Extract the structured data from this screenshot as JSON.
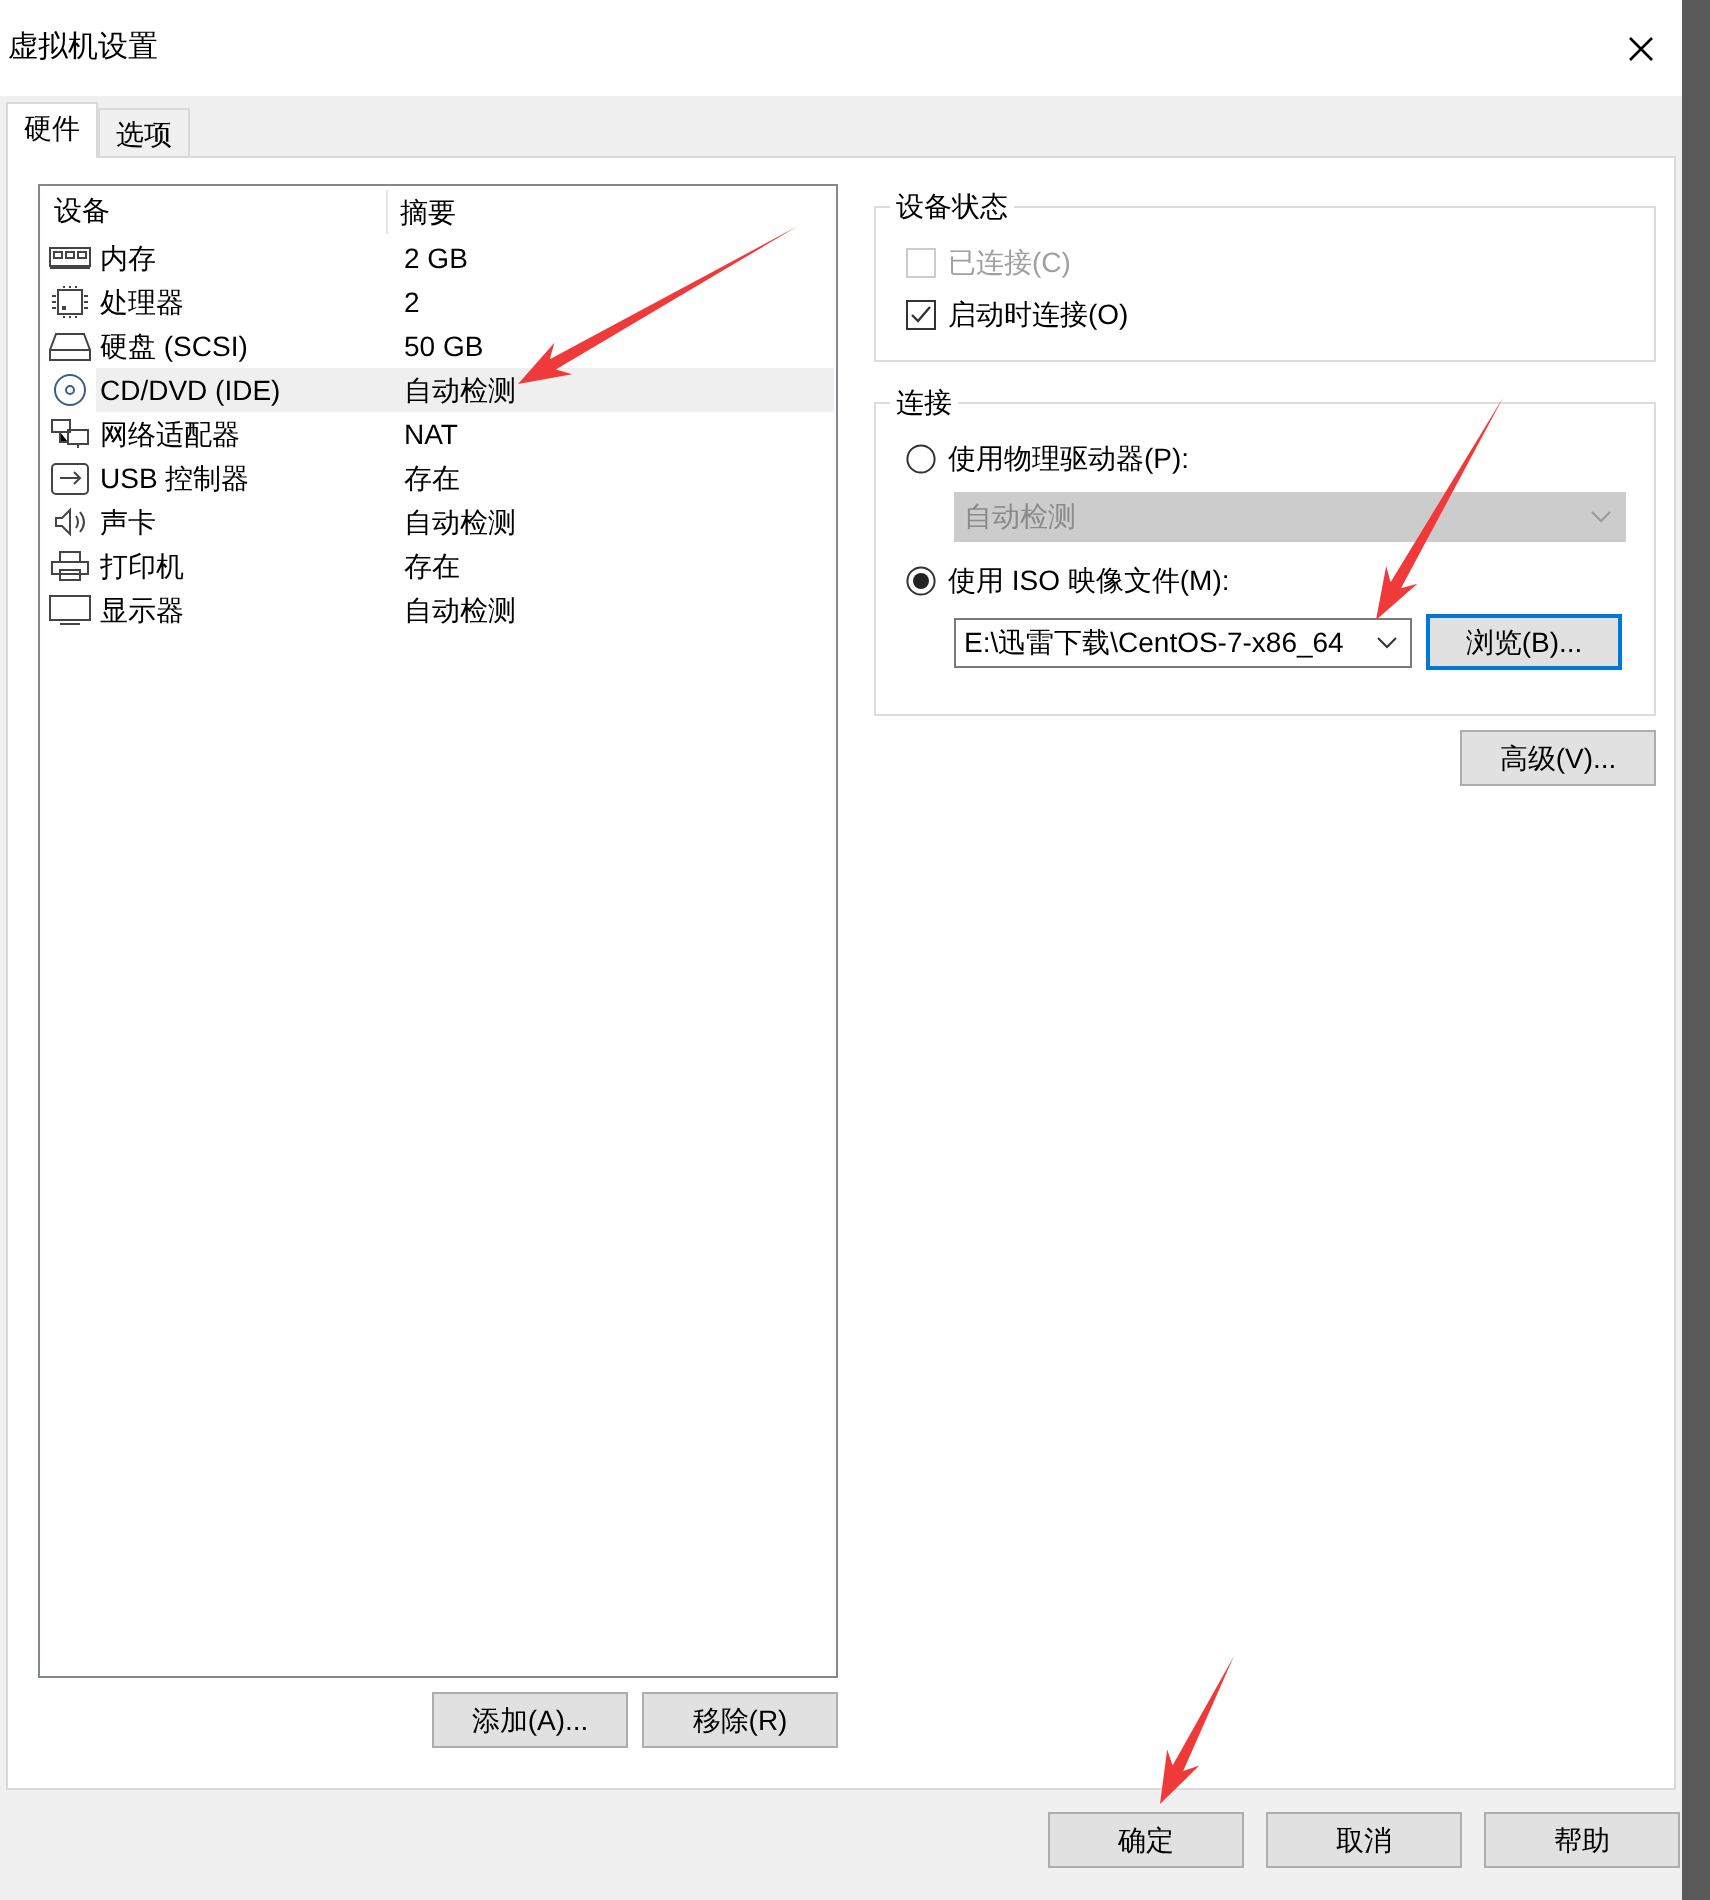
{
  "window": {
    "title": "虚拟机设置"
  },
  "tabs": [
    {
      "label": "硬件",
      "selected": true
    },
    {
      "label": "选项",
      "selected": false
    }
  ],
  "device_list": {
    "columns": [
      "设备",
      "摘要"
    ],
    "rows": [
      {
        "kind": "memory",
        "device": "内存",
        "summary": "2 GB",
        "selected": false
      },
      {
        "kind": "cpu",
        "device": "处理器",
        "summary": "2",
        "selected": false
      },
      {
        "kind": "disk",
        "device": "硬盘 (SCSI)",
        "summary": "50 GB",
        "selected": false
      },
      {
        "kind": "cd",
        "device": "CD/DVD (IDE)",
        "summary": "自动检测",
        "selected": true
      },
      {
        "kind": "network",
        "device": "网络适配器",
        "summary": "NAT",
        "selected": false
      },
      {
        "kind": "usb",
        "device": "USB 控制器",
        "summary": "存在",
        "selected": false
      },
      {
        "kind": "sound",
        "device": "声卡",
        "summary": "自动检测",
        "selected": false
      },
      {
        "kind": "printer",
        "device": "打印机",
        "summary": "存在",
        "selected": false
      },
      {
        "kind": "display",
        "device": "显示器",
        "summary": "自动检测",
        "selected": false
      }
    ]
  },
  "list_buttons": [
    "添加(A)...",
    "移除(R)"
  ],
  "device_status": {
    "title": "设备状态",
    "options": [
      {
        "label": "已连接(C)",
        "checked": false,
        "disabled": true
      },
      {
        "label": "启动时连接(O)",
        "checked": true,
        "disabled": false
      }
    ]
  },
  "connection": {
    "title": "连接",
    "options": [
      {
        "label": "使用物理驱动器(P):",
        "selected": false,
        "dropdown": {
          "value": "自动检测",
          "disabled": true
        }
      },
      {
        "label": "使用 ISO 映像文件(M):",
        "selected": true,
        "dropdown": {
          "value": "E:\\迅雷下载\\CentOS-7-x86_64",
          "disabled": false
        },
        "button": {
          "label": "浏览(B)...",
          "focused": true
        }
      }
    ]
  },
  "advanced_button": "高级(V)...",
  "footer_buttons": [
    "确定",
    "取消",
    "帮助"
  ]
}
